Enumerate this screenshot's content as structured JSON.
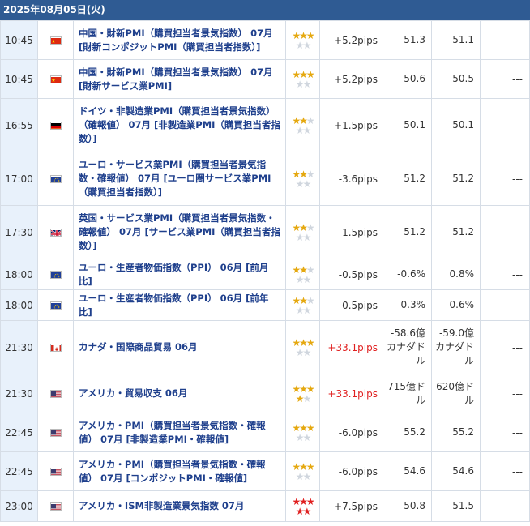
{
  "header": {
    "date": "2025年08月05日(火)"
  },
  "rows": [
    {
      "time": "10:45",
      "country": "cn",
      "title": "中国・財新PMI（購買担当者景気指数） 07月 [財新コンポジットPMI（購買担当者指数）]",
      "stars": 3,
      "star_color": "gold",
      "pips": "+5.2pips",
      "pips_big": false,
      "v1": "51.3",
      "v2": "51.1",
      "v3": "---"
    },
    {
      "time": "10:45",
      "country": "cn",
      "title": "中国・財新PMI（購買担当者景気指数） 07月 [財新サービス業PMI]",
      "stars": 3,
      "star_color": "gold",
      "pips": "+5.2pips",
      "pips_big": false,
      "v1": "50.6",
      "v2": "50.5",
      "v3": "---"
    },
    {
      "time": "16:55",
      "country": "de",
      "title": "ドイツ・非製造業PMI（購買担当者景気指数）（確報値） 07月 [非製造業PMI（購買担当者指数）]",
      "stars": 2,
      "star_color": "gold",
      "pips": "+1.5pips",
      "pips_big": false,
      "v1": "50.1",
      "v2": "50.1",
      "v3": "---"
    },
    {
      "time": "17:00",
      "country": "eu",
      "title": "ユーロ・サービス業PMI（購買担当者景気指数・確報値） 07月 [ユーロ圏サービス業PMI（購買担当者指数）]",
      "stars": 2,
      "star_color": "gold",
      "pips": "-3.6pips",
      "pips_big": false,
      "v1": "51.2",
      "v2": "51.2",
      "v3": "---"
    },
    {
      "time": "17:30",
      "country": "gb",
      "title": "英国・サービス業PMI（購買担当者景気指数・確報値） 07月 [サービス業PMI（購買担当者指数）]",
      "stars": 2,
      "star_color": "gold",
      "pips": "-1.5pips",
      "pips_big": false,
      "v1": "51.2",
      "v2": "51.2",
      "v3": "---"
    },
    {
      "time": "18:00",
      "country": "eu",
      "title": "ユーロ・生産者物価指数（PPI） 06月 [前月比]",
      "stars": 2,
      "star_color": "gold",
      "pips": "-0.5pips",
      "pips_big": false,
      "v1": "-0.6%",
      "v2": "0.8%",
      "v3": "---"
    },
    {
      "time": "18:00",
      "country": "eu",
      "title": "ユーロ・生産者物価指数（PPI） 06月 [前年比]",
      "stars": 2,
      "star_color": "gold",
      "pips": "-0.5pips",
      "pips_big": false,
      "v1": "0.3%",
      "v2": "0.6%",
      "v3": "---"
    },
    {
      "time": "21:30",
      "country": "ca",
      "title": "カナダ・国際商品貿易 06月",
      "stars": 3,
      "star_color": "gold",
      "pips": "+33.1pips",
      "pips_big": true,
      "v1": "-58.6億カナダドル",
      "v2": "-59.0億カナダドル",
      "v3": "---"
    },
    {
      "time": "21:30",
      "country": "us",
      "title": "アメリカ・貿易収支 06月",
      "stars": 4,
      "star_color": "gold",
      "pips": "+33.1pips",
      "pips_big": true,
      "v1": "-715億ドル",
      "v2": "-620億ドル",
      "v3": "---"
    },
    {
      "time": "22:45",
      "country": "us",
      "title": "アメリカ・PMI（購買担当者景気指数・確報値） 07月 [非製造業PMI・確報値]",
      "stars": 3,
      "star_color": "gold",
      "pips": "-6.0pips",
      "pips_big": false,
      "v1": "55.2",
      "v2": "55.2",
      "v3": "---"
    },
    {
      "time": "22:45",
      "country": "us",
      "title": "アメリカ・PMI（購買担当者景気指数・確報値） 07月 [コンポジットPMI・確報値]",
      "stars": 3,
      "star_color": "gold",
      "pips": "-6.0pips",
      "pips_big": false,
      "v1": "54.6",
      "v2": "54.6",
      "v3": "---"
    },
    {
      "time": "23:00",
      "country": "us",
      "title": "アメリカ・ISM非製造業景気指数 07月",
      "stars": 5,
      "star_color": "red",
      "pips": "+7.5pips",
      "pips_big": false,
      "v1": "50.8",
      "v2": "51.5",
      "v3": "---"
    }
  ]
}
